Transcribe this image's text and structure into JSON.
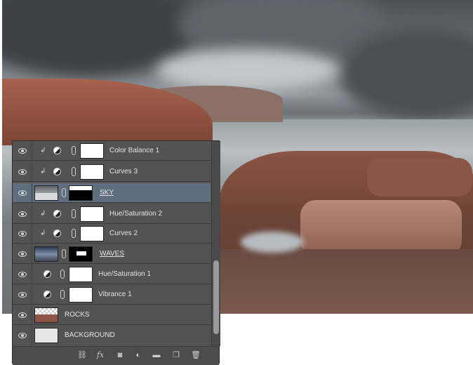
{
  "panel": {
    "layers": [
      {
        "name": "Color Balance 1",
        "type": "adjustment",
        "clipped": true,
        "selected": false,
        "underlined": false
      },
      {
        "name": "Curves 3",
        "type": "adjustment",
        "clipped": true,
        "selected": false,
        "underlined": false
      },
      {
        "name": "SKY",
        "type": "image",
        "clipped": false,
        "selected": true,
        "underlined": true
      },
      {
        "name": "Hue/Saturation 2",
        "type": "adjustment",
        "clipped": true,
        "selected": false,
        "underlined": false
      },
      {
        "name": "Curves 2",
        "type": "adjustment",
        "clipped": true,
        "selected": false,
        "underlined": false
      },
      {
        "name": "WAVES",
        "type": "image",
        "clipped": false,
        "selected": false,
        "underlined": true
      },
      {
        "name": "Hue/Saturation 1",
        "type": "adjustment",
        "clipped": false,
        "selected": false,
        "underlined": false
      },
      {
        "name": "Vibrance 1",
        "type": "adjustment",
        "clipped": false,
        "selected": false,
        "underlined": false
      },
      {
        "name": "ROCKS",
        "type": "pixel",
        "clipped": false,
        "selected": false,
        "underlined": false
      },
      {
        "name": "BACKGROUND",
        "type": "background",
        "clipped": false,
        "selected": false,
        "underlined": false
      }
    ],
    "footer": {
      "link_icon": "link-icon",
      "fx_label": "fx",
      "mask_icon": "mask-icon",
      "adjustment_icon": "adjustment-icon",
      "group_icon": "folder-icon",
      "new_layer_icon": "new-layer-icon",
      "delete_icon": "trash-icon"
    }
  },
  "colors": {
    "panel_bg": "#535353",
    "selected_row": "#5f6d7e",
    "text": "#e4e4e4"
  }
}
